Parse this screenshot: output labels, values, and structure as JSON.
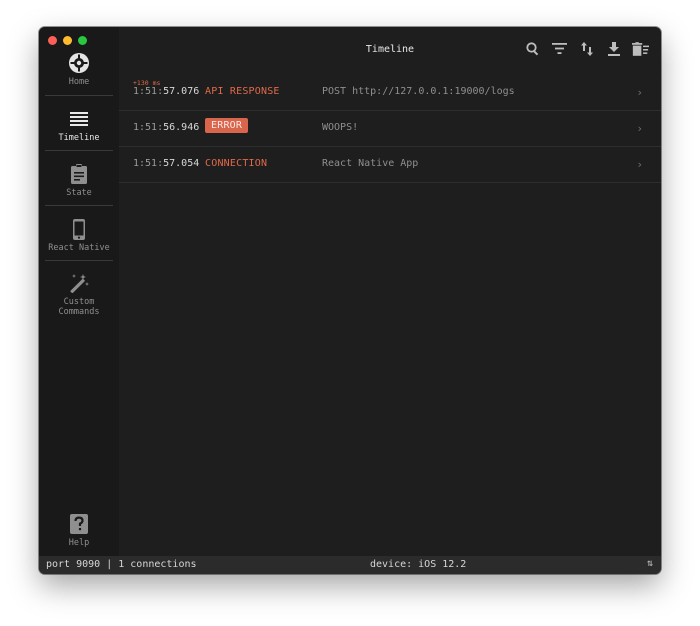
{
  "window": {
    "title": "Timeline"
  },
  "sidebar": {
    "items": [
      {
        "label": "Home",
        "icon": "home-logo-icon"
      },
      {
        "label": "Timeline",
        "icon": "list-icon"
      },
      {
        "label": "State",
        "icon": "clipboard-icon"
      },
      {
        "label": "React Native",
        "icon": "phone-icon"
      },
      {
        "label_line1": "Custom",
        "label_line2": "Commands",
        "icon": "magic-wand-icon"
      },
      {
        "label": "Help",
        "icon": "help-icon"
      }
    ],
    "active": "Timeline"
  },
  "toolbar": {
    "icons": [
      "search-icon",
      "filter-icon",
      "sort-icon",
      "download-icon",
      "delete-icon"
    ]
  },
  "timeline": {
    "rows": [
      {
        "delta": "+130 ms",
        "time_prefix": "1:51:",
        "time_main": "57.076",
        "type": "API RESPONSE",
        "message": "POST http://127.0.0.1:19000/logs",
        "chevron": "›"
      },
      {
        "delta": "",
        "time_prefix": "1:51:",
        "time_main": "56.946",
        "type": "ERROR",
        "message": "WOOPS!",
        "chevron": "›"
      },
      {
        "delta": "",
        "time_prefix": "1:51:",
        "time_main": "57.054",
        "type": "CONNECTION",
        "message": "React Native App",
        "chevron": "›"
      }
    ]
  },
  "statusbar": {
    "connection": "port 9090 | 1 connections",
    "device": "device: iOS 12.2",
    "toggle_glyph": "⇅"
  },
  "colors": {
    "accent": "#e0694a",
    "error_badge": "#d9654c",
    "background": "#1e1e1e",
    "sidebar": "#191919"
  }
}
